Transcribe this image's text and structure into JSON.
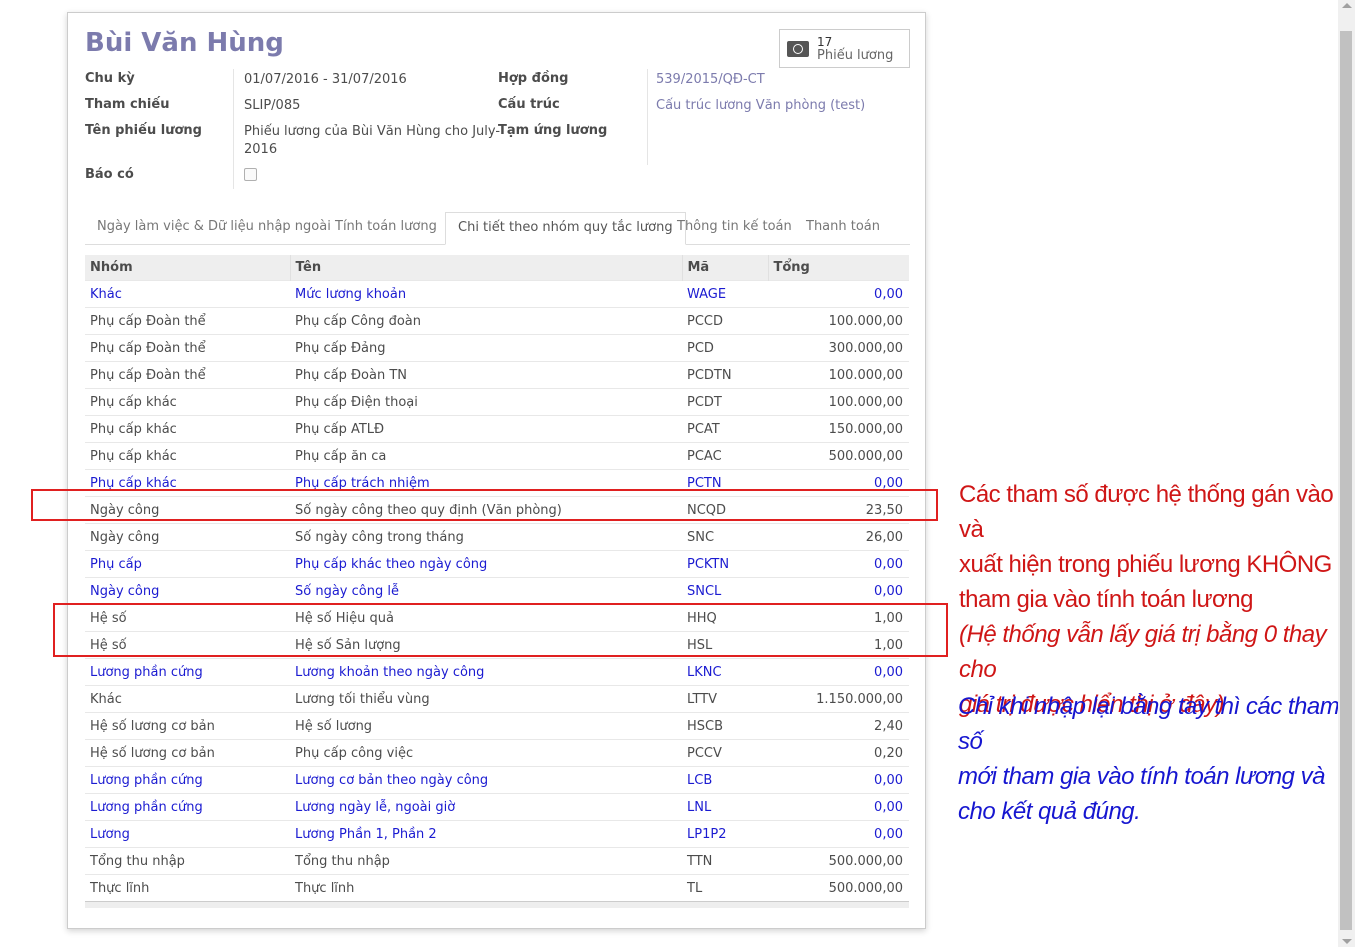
{
  "form": {
    "title": "Bùi Văn Hùng",
    "stat_button": {
      "count": "17",
      "label": "Phiếu lương",
      "icon": "money-icon"
    },
    "left_fields": [
      {
        "label": "Chu kỳ",
        "value": "01/07/2016  -  31/07/2016"
      },
      {
        "label": "Tham chiếu",
        "value": "SLIP/085"
      },
      {
        "label": "Tên phiếu lương",
        "value_line1": "Phiếu lương của Bùi Văn Hùng cho July-",
        "value_line2": "2016"
      },
      {
        "label": "Báo có",
        "checked": false
      }
    ],
    "right_fields": [
      {
        "label": "Hợp đồng",
        "value": "539/2015/QĐ-CT"
      },
      {
        "label": "Cấu trúc",
        "value": "Cấu trúc lương Văn phòng (test)"
      },
      {
        "label": "Tạm ứng lương",
        "value": ""
      }
    ]
  },
  "tabs": [
    {
      "label": "Ngày làm việc & Dữ liệu nhập ngoài",
      "active": false
    },
    {
      "label": "Tính toán lương",
      "active": false
    },
    {
      "label": "Chi tiết theo nhóm quy tắc lương",
      "active": true
    },
    {
      "label": "Thông tin kế toán",
      "active": false
    },
    {
      "label": "Thanh toán",
      "active": false
    }
  ],
  "table": {
    "columns": [
      "Nhóm",
      "Tên",
      "Mã",
      "Tổng"
    ],
    "rows": [
      {
        "group": "Khác",
        "name": "Mức lương khoản",
        "code": "WAGE",
        "total": "0,00",
        "style": "blue"
      },
      {
        "group": "Phụ cấp Đoàn thể",
        "name": "Phụ cấp Công đoàn",
        "code": "PCCD",
        "total": "100.000,00",
        "style": "dark"
      },
      {
        "group": "Phụ cấp Đoàn thể",
        "name": "Phụ cấp Đảng",
        "code": "PCD",
        "total": "300.000,00",
        "style": "dark"
      },
      {
        "group": "Phụ cấp Đoàn thể",
        "name": "Phụ cấp Đoàn TN",
        "code": "PCDTN",
        "total": "100.000,00",
        "style": "dark"
      },
      {
        "group": "Phụ cấp khác",
        "name": "Phụ cấp Điện thoại",
        "code": "PCDT",
        "total": "100.000,00",
        "style": "dark"
      },
      {
        "group": "Phụ cấp khác",
        "name": "Phụ cấp ATLĐ",
        "code": "PCAT",
        "total": "150.000,00",
        "style": "dark"
      },
      {
        "group": "Phụ cấp khác",
        "name": "Phụ cấp ăn ca",
        "code": "PCAC",
        "total": "500.000,00",
        "style": "dark"
      },
      {
        "group": "Phụ cấp khác",
        "name": "Phụ cấp trách nhiệm",
        "code": "PCTN",
        "total": "0,00",
        "style": "blue"
      },
      {
        "group": "Ngày công",
        "name": "Số ngày công theo quy định (Văn phòng)",
        "code": "NCQD",
        "total": "23,50",
        "style": "dark"
      },
      {
        "group": "Ngày công",
        "name": "Số ngày công trong tháng",
        "code": "SNC",
        "total": "26,00",
        "style": "dark"
      },
      {
        "group": "Phụ cấp",
        "name": "Phụ cấp khác theo ngày công",
        "code": "PCKTN",
        "total": "0,00",
        "style": "blue"
      },
      {
        "group": "Ngày công",
        "name": "Số ngày công lễ",
        "code": "SNCL",
        "total": "0,00",
        "style": "blue"
      },
      {
        "group": "Hệ số",
        "name": "Hệ số Hiệu quả",
        "code": "HHQ",
        "total": "1,00",
        "style": "dark"
      },
      {
        "group": "Hệ số",
        "name": "Hệ số Sản lượng",
        "code": "HSL",
        "total": "1,00",
        "style": "dark"
      },
      {
        "group": "Lương phần cứng",
        "name": "Lương khoản theo ngày công",
        "code": "LKNC",
        "total": "0,00",
        "style": "blue"
      },
      {
        "group": "Khác",
        "name": "Lương tối thiểu vùng",
        "code": "LTTV",
        "total": "1.150.000,00",
        "style": "dark"
      },
      {
        "group": "Hệ số lương cơ bản",
        "name": "Hệ số lương",
        "code": "HSCB",
        "total": "2,40",
        "style": "dark"
      },
      {
        "group": "Hệ số lương cơ bản",
        "name": "Phụ cấp công việc",
        "code": "PCCV",
        "total": "0,20",
        "style": "dark"
      },
      {
        "group": "Lương phần cứng",
        "name": "Lương cơ bản theo ngày công",
        "code": "LCB",
        "total": "0,00",
        "style": "blue"
      },
      {
        "group": "Lương phần cứng",
        "name": "Lương ngày lễ, ngoài giờ",
        "code": "LNL",
        "total": "0,00",
        "style": "blue"
      },
      {
        "group": "Lương",
        "name": "Lương Phần 1, Phần 2",
        "code": "LP1P2",
        "total": "0,00",
        "style": "blue"
      },
      {
        "group": "Tổng thu nhập",
        "name": "Tổng thu nhập",
        "code": "TTN",
        "total": "500.000,00",
        "style": "dark"
      },
      {
        "group": "Thực lĩnh",
        "name": "Thực lĩnh",
        "code": "TL",
        "total": "500.000,00",
        "style": "dark"
      }
    ]
  },
  "annotations": {
    "red_lines": [
      "Các tham số được hệ thống gán vào và",
      "xuất hiện trong phiếu lương KHÔNG",
      "tham gia vào tính toán lương"
    ],
    "red_italic_lines": [
      "(Hệ thống vẫn lấy giá trị bằng 0 thay cho",
      "giá trị được hiển thị ở đây)"
    ],
    "blue_lines": [
      "Chỉ khi nhập lại bằng tay thì các tham số",
      "mới tham gia vào tính toán lương và",
      "cho kết quả đúng."
    ]
  },
  "colors": {
    "title": "#7c7bad",
    "link_blue": "#1b1bd1",
    "annotation_red": "#cf1616",
    "annotation_blue": "#1616d0",
    "highlight_box": "#e02020"
  }
}
